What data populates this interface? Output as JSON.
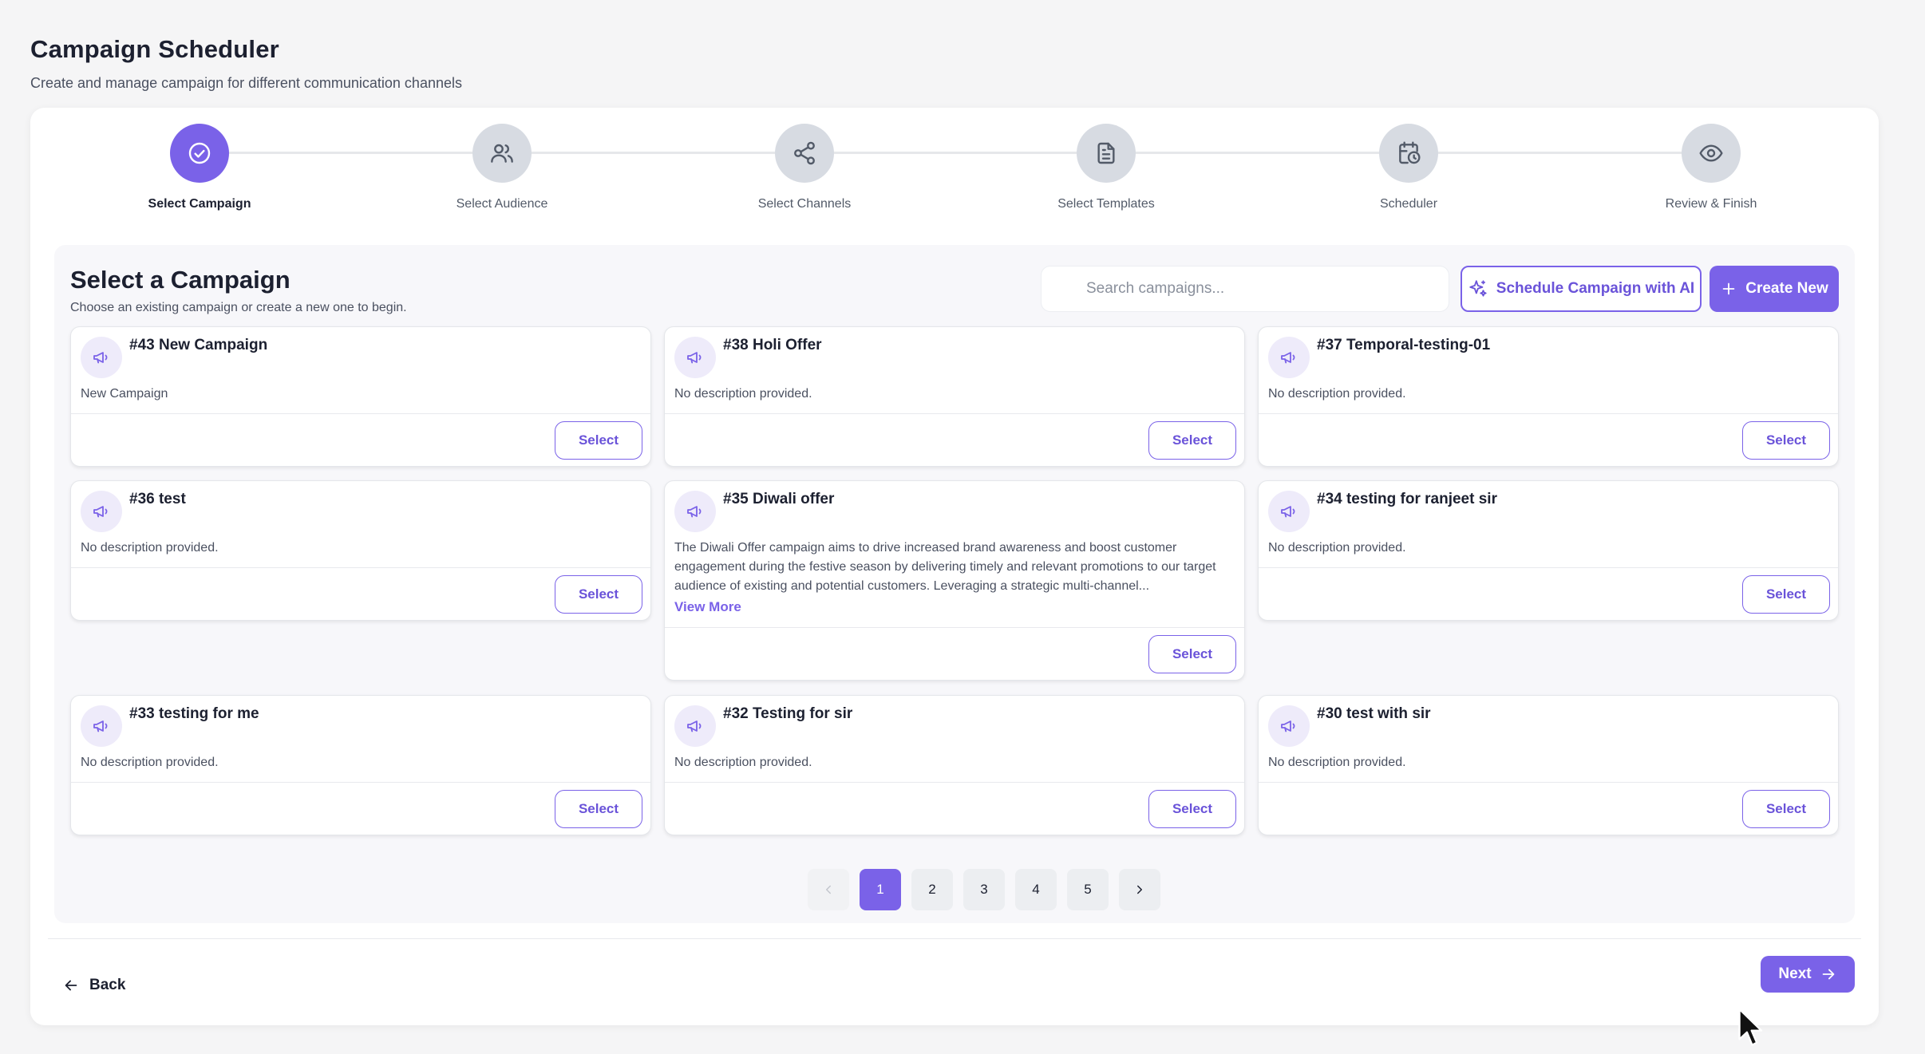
{
  "header": {
    "title": "Campaign Scheduler",
    "subtitle": "Create and manage campaign for different communication channels"
  },
  "stepper": {
    "steps": [
      {
        "label": "Select Campaign",
        "icon": "check-circle-icon",
        "active": true
      },
      {
        "label": "Select Audience",
        "icon": "users-icon",
        "active": false
      },
      {
        "label": "Select Channels",
        "icon": "share-icon",
        "active": false
      },
      {
        "label": "Select Templates",
        "icon": "document-icon",
        "active": false
      },
      {
        "label": "Scheduler",
        "icon": "calendar-clock-icon",
        "active": false
      },
      {
        "label": "Review & Finish",
        "icon": "eye-icon",
        "active": false
      }
    ]
  },
  "section": {
    "title": "Select a Campaign",
    "subtitle": "Choose an existing campaign or create a new one to begin."
  },
  "search": {
    "placeholder": "Search campaigns...",
    "value": ""
  },
  "actions": {
    "ai_label": "Schedule Campaign with AI",
    "create_label": "Create New"
  },
  "campaigns": [
    {
      "title": "#43 New Campaign",
      "description": "New Campaign",
      "select_label": "Select"
    },
    {
      "title": "#38 Holi Offer",
      "description": "No description provided.",
      "select_label": "Select"
    },
    {
      "title": "#37 Temporal-testing-01",
      "description": "No description provided.",
      "select_label": "Select"
    },
    {
      "title": "#36 test",
      "description": "No description provided.",
      "select_label": "Select"
    },
    {
      "title": "#35 Diwali offer",
      "description": "The Diwali Offer campaign aims to drive increased brand awareness and boost customer engagement during the festive season by delivering timely and relevant promotions to our target audience of existing and potential customers. Leveraging a strategic multi-channel...",
      "view_more": "View More",
      "select_label": "Select"
    },
    {
      "title": "#34 testing for ranjeet sir",
      "description": "No description provided.",
      "select_label": "Select"
    },
    {
      "title": "#33 testing for me",
      "description": "No description provided.",
      "select_label": "Select"
    },
    {
      "title": "#32 Testing for sir",
      "description": "No description provided.",
      "select_label": "Select"
    },
    {
      "title": "#30 test with sir",
      "description": "No description provided.",
      "select_label": "Select"
    }
  ],
  "pagination": {
    "pages": [
      "1",
      "2",
      "3",
      "4",
      "5"
    ],
    "current": "1"
  },
  "footer": {
    "back_label": "Back",
    "next_label": "Next"
  },
  "colors": {
    "accent": "#7a62e8",
    "step_inactive": "#d7dbe2"
  }
}
